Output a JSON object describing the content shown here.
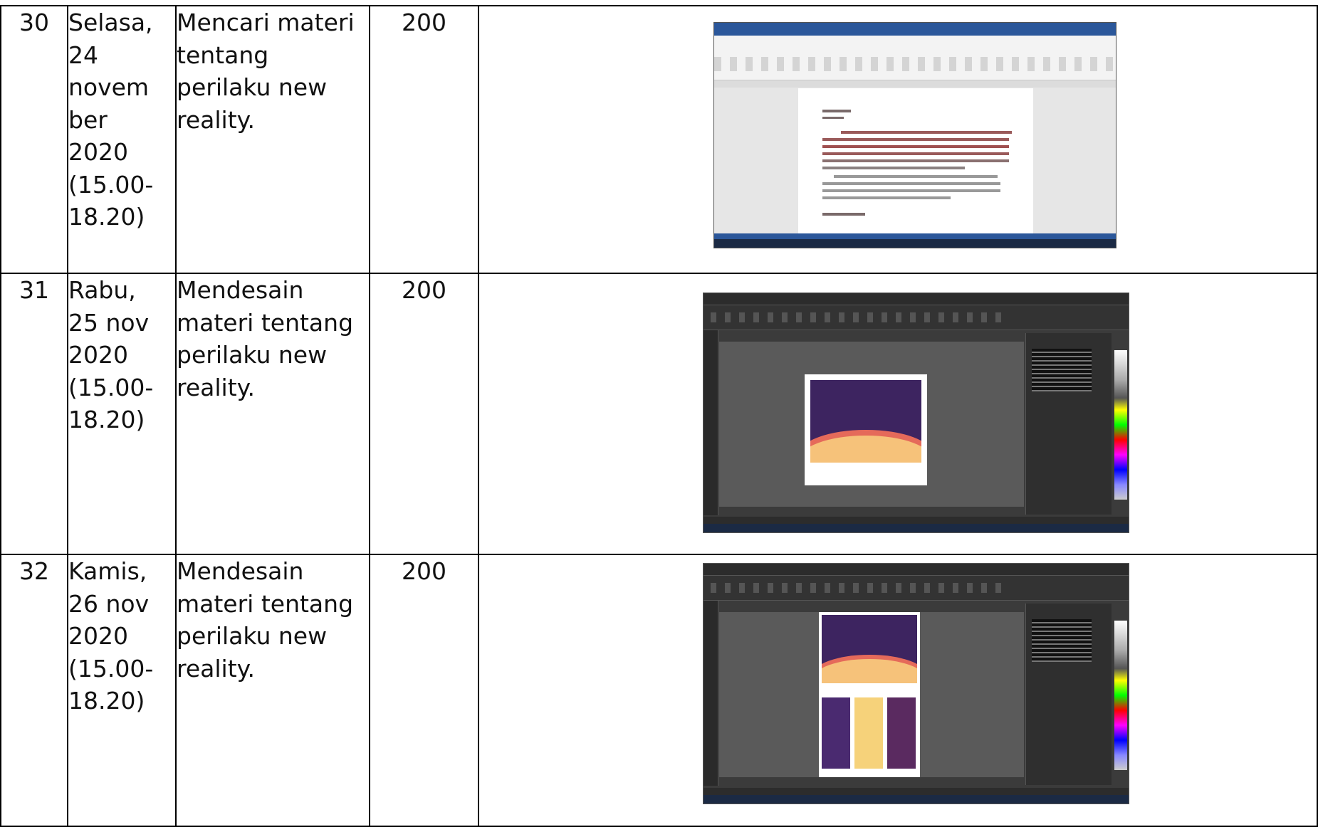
{
  "rows": [
    {
      "no": "30",
      "day": "Selasa,\n24\nnovem\nber\n2020\n(15.00-\n18.20)",
      "activity": "Mencari materi\ntentang\nperilaku new\nreality.",
      "minutes": "200"
    },
    {
      "no": "31",
      "day": "Rabu,\n25 nov\n2020\n(15.00-\n18.20)",
      "activity": "Mendesain\nmateri tentang\nperilaku new\nreality.",
      "minutes": "200"
    },
    {
      "no": "32",
      "day": "Kamis,\n26 nov\n2020\n(15.00-\n18.20)",
      "activity": "Mendesain\nmateri tentang\nperilaku new\nreality.",
      "minutes": "200"
    }
  ],
  "colors": {
    "border": "#000000",
    "word_accent": "#2b579a",
    "corel_bg": "#3b3b3b",
    "poster_purple": "#3d2460"
  }
}
